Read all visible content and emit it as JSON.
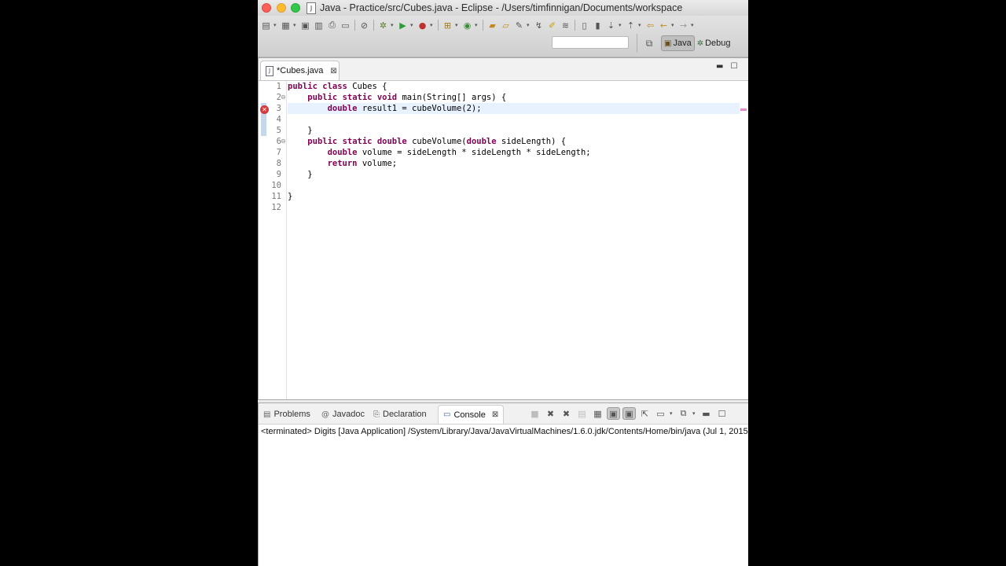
{
  "window": {
    "title": "Java - Practice/src/Cubes.java - Eclipse - /Users/timfinnigan/Documents/workspace",
    "file_icon": "java-file-icon"
  },
  "toolbar": {
    "quick_access_placeholder": "",
    "perspectives": [
      {
        "label": "Java",
        "icon": "java-perspective-icon",
        "active": true
      },
      {
        "label": "Debug",
        "icon": "debug-perspective-icon",
        "active": false
      }
    ]
  },
  "editor": {
    "tab_label": "*Cubes.java",
    "lines": [
      {
        "num": "1",
        "code": "public class Cubes {"
      },
      {
        "num": "2",
        "code": "    public static void main(String[] args) {"
      },
      {
        "num": "3",
        "code": "        double result1 = cubeVolume(2);"
      },
      {
        "num": "4",
        "code": ""
      },
      {
        "num": "5",
        "code": "    }"
      },
      {
        "num": "6",
        "code": "    public static double cubeVolume(double sideLength) {"
      },
      {
        "num": "7",
        "code": "        double volume = sideLength * sideLength * sideLength;"
      },
      {
        "num": "8",
        "code": "        return volume;"
      },
      {
        "num": "9",
        "code": "    }"
      },
      {
        "num": "10",
        "code": ""
      },
      {
        "num": "11",
        "code": "}"
      },
      {
        "num": "12",
        "code": ""
      }
    ],
    "error_line": "3",
    "current_line": "3",
    "colors": {
      "keyword": "#7f0055",
      "error": "#d8383b",
      "current_line_bg": "#e8f2fe"
    }
  },
  "bottom_panel": {
    "tabs": [
      {
        "label": "Problems",
        "icon": "problems-icon"
      },
      {
        "label": "Javadoc",
        "icon": "javadoc-icon"
      },
      {
        "label": "Declaration",
        "icon": "declaration-icon"
      },
      {
        "label": "Console",
        "icon": "console-icon",
        "active": true
      }
    ],
    "console_status": "<terminated> Digits [Java Application] /System/Library/Java/JavaVirtualMachines/1.6.0.jdk/Contents/Home/bin/java (Jul 1, 2015"
  }
}
